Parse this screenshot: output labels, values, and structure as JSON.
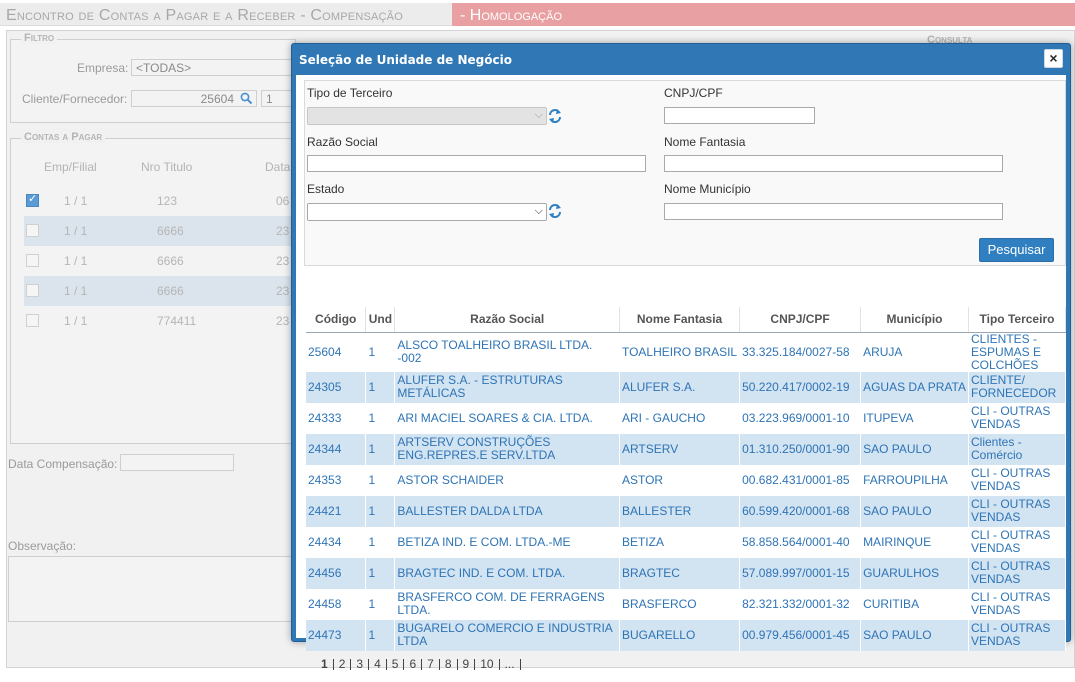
{
  "page": {
    "title": "Encontro de Contas a Pagar e a Receber - Compensação",
    "env_label": "- Homologação"
  },
  "filter": {
    "legend": "Filtro",
    "empresa_label": "Empresa:",
    "empresa_value": "<TODAS>",
    "cliente_label": "Cliente/Fornecedor:",
    "cliente_value": "25604",
    "cliente_value2": "1",
    "consulta_label": "Consulta"
  },
  "contas_pagar": {
    "legend": "Contas a Pagar",
    "headers": [
      "Emp/Filial",
      "Nro Titulo",
      "Data"
    ],
    "rows": [
      {
        "emp": "1 / 1",
        "nro": "123",
        "data": "06",
        "checked": true
      },
      {
        "emp": "1 / 1",
        "nro": "6666",
        "data": "23",
        "checked": false
      },
      {
        "emp": "1 / 1",
        "nro": "6666",
        "data": "23",
        "checked": false
      },
      {
        "emp": "1 / 1",
        "nro": "6666",
        "data": "23",
        "checked": false
      },
      {
        "emp": "1 / 1",
        "nro": "774411",
        "data": "23",
        "checked": false
      }
    ]
  },
  "data_compensacao_label": "Data Compensação:",
  "observacao_label": "Observação:",
  "modal": {
    "title": "Seleção de Unidade de Negócio",
    "close_label": "×",
    "tipo_terceiro_label": "Tipo de Terceiro",
    "cnpj_label": "CNPJ/CPF",
    "razao_label": "Razão Social",
    "fantasia_label": "Nome Fantasia",
    "estado_label": "Estado",
    "municipio_label": "Nome Município",
    "search_button": "Pesquisar",
    "table": {
      "headers": [
        "Código",
        "Und",
        "Razão Social",
        "Nome Fantasia",
        "CNPJ/CPF",
        "Município",
        "Tipo Terceiro"
      ],
      "rows": [
        [
          "25604",
          "1",
          "ALSCO TOALHEIRO BRASIL LTDA. -002",
          "TOALHEIRO BRASIL",
          "33.325.184/0027-58",
          "ARUJA",
          "CLIENTES - ESPUMAS E COLCHÕES"
        ],
        [
          "24305",
          "1",
          "ALUFER S.A. - ESTRUTURAS METÁLICAS",
          "ALUFER S.A.",
          "50.220.417/0002-19",
          "AGUAS DA PRATA",
          "CLIENTE/ FORNECEDOR"
        ],
        [
          "24333",
          "1",
          "ARI MACIEL SOARES & CIA. LTDA.",
          "ARI - GAUCHO",
          "03.223.969/0001-10",
          "ITUPEVA",
          "CLI - OUTRAS VENDAS"
        ],
        [
          "24344",
          "1",
          "ARTSERV CONSTRUÇÕES ENG.REPRES.E SERV.LTDA",
          "ARTSERV",
          "01.310.250/0001-90",
          "SAO PAULO",
          "Clientes - Comércio"
        ],
        [
          "24353",
          "1",
          "ASTOR SCHAIDER",
          "ASTOR",
          "00.682.431/0001-85",
          "FARROUPILHA",
          "CLI - OUTRAS VENDAS"
        ],
        [
          "24421",
          "1",
          "BALLESTER DALDA LTDA",
          "BALLESTER",
          "60.599.420/0001-68",
          "SAO PAULO",
          "CLI - OUTRAS VENDAS"
        ],
        [
          "24434",
          "1",
          "BETIZA IND. E COM. LTDA.-ME",
          "BETIZA",
          "58.858.564/0001-40",
          "MAIRINQUE",
          "CLI - OUTRAS VENDAS"
        ],
        [
          "24456",
          "1",
          "BRAGTEC IND. E COM. LTDA.",
          "BRAGTEC",
          "57.089.997/0001-15",
          "GUARULHOS",
          "CLI - OUTRAS VENDAS"
        ],
        [
          "24458",
          "1",
          "BRASFERCO COM. DE FERRAGENS LTDA.",
          "BRASFERCO",
          "82.321.332/0001-32",
          "CURITIBA",
          "CLI - OUTRAS VENDAS"
        ],
        [
          "24473",
          "1",
          "BUGARELO COMERCIO E INDUSTRIA LTDA",
          "BUGARELLO",
          "00.979.456/0001-45",
          "SAO PAULO",
          "CLI - OUTRAS VENDAS"
        ]
      ]
    },
    "pager": [
      "1",
      "2",
      "3",
      "4",
      "5",
      "6",
      "7",
      "8",
      "9",
      "10",
      "..."
    ],
    "current_page": "1"
  },
  "colors": {
    "modal_header": "#2f78b5",
    "row_alt": "#d2e3f2",
    "link_text": "#2e74b5",
    "env_banner": "#e9a0a2"
  }
}
